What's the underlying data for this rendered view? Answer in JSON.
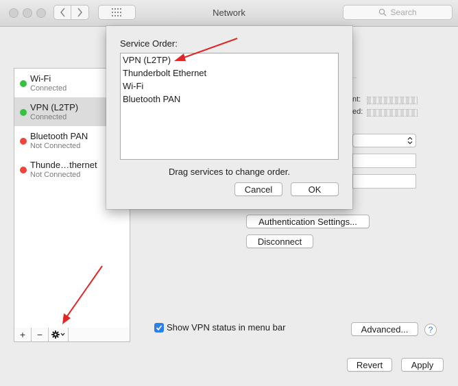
{
  "window": {
    "title": "Network",
    "search_placeholder": "Search"
  },
  "sidebar": {
    "items": [
      {
        "name": "Wi-Fi",
        "status": "Connected",
        "dot_color": "#35c33e"
      },
      {
        "name": "VPN (L2TP)",
        "status": "Connected",
        "dot_color": "#35c33e"
      },
      {
        "name": "Bluetooth PAN",
        "status": "Not Connected",
        "dot_color": "#f0443b"
      },
      {
        "name": "Thunde…thernet",
        "status": "Not Connected",
        "dot_color": "#f0443b"
      }
    ],
    "add_label": "+",
    "remove_label": "−"
  },
  "sheet": {
    "title": "Service Order:",
    "services": [
      "VPN (L2TP)",
      "Thunderbolt Ethernet",
      "Wi-Fi",
      "Bluetooth PAN"
    ],
    "hint": "Drag services to change order.",
    "cancel_label": "Cancel",
    "ok_label": "OK"
  },
  "detail": {
    "label_1": "nt:",
    "label_2": "ed:",
    "auth_settings_label": "Authentication Settings...",
    "disconnect_label": "Disconnect",
    "show_vpn_status_label": "Show VPN status in menu bar",
    "show_vpn_status_checked": true,
    "advanced_label": "Advanced...",
    "help_label": "?",
    "revert_label": "Revert",
    "apply_label": "Apply"
  },
  "colors": {
    "connected": "#35c33e",
    "not_connected": "#f0443b",
    "annotation_arrow": "#e02626",
    "checkbox_accent": "#2a7fe8"
  }
}
